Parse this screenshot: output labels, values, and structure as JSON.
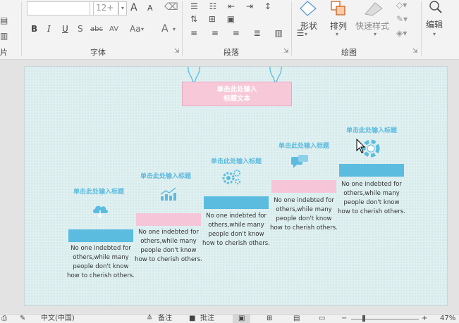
{
  "ribbon": {
    "font_group_label": "字体",
    "paragraph_group_label": "段落",
    "drawing_group_label": "绘图",
    "font_size_value": "12+",
    "font_buttons": [
      "B",
      "I",
      "U",
      "S",
      "abc",
      "AV",
      "Aa",
      "A"
    ],
    "grow_font": "A",
    "shrink_font": "A",
    "shape_label": "形状",
    "arrange_label": "排列",
    "quick_styles_label": "快速样式",
    "editing_label": "编辑",
    "left_partial_label": "片"
  },
  "slide": {
    "title_line1": "单击此处输入",
    "title_line2": "标题文本",
    "steps": [
      {
        "title": "单击此处输入标题",
        "desc_lines": [
          "No one indebted for",
          "others,while many",
          "people don't know",
          "how to cherish others."
        ],
        "color": "#5bbce0",
        "icon": "cloud-upload-icon"
      },
      {
        "title": "单击此处输入标题",
        "desc_lines": [
          "No one indebted for",
          "others,while many",
          "people don't know",
          "how to cherish others."
        ],
        "color": "#f7c5d8",
        "icon": "growth-chart-icon"
      },
      {
        "title": "单击此处输入标题",
        "desc_lines": [
          "No one indebted for",
          "others,while many",
          "people don't know",
          "how to cherish others."
        ],
        "color": "#5bbce0",
        "icon": "gears-icon"
      },
      {
        "title": "单击此处输入标题",
        "desc_lines": [
          "No one indebted for",
          "others,while many",
          "people don't know",
          "how to cherish others."
        ],
        "color": "#f7c5d8",
        "icon": "chat-bubbles-icon"
      },
      {
        "title": "单击此处输入标题",
        "desc_lines": [
          "No one indebted for",
          "others,while many",
          "people don't know",
          "how to cherish others."
        ],
        "color": "#5bbce0",
        "icon": "lifebuoy-icon"
      }
    ]
  },
  "statusbar": {
    "language": "中文(中国)",
    "notes_label": "备注",
    "comments_label": "批注",
    "zoom": "47%"
  },
  "colors": {
    "accent_blue": "#5bbce0",
    "accent_pink": "#f7c5d8"
  }
}
